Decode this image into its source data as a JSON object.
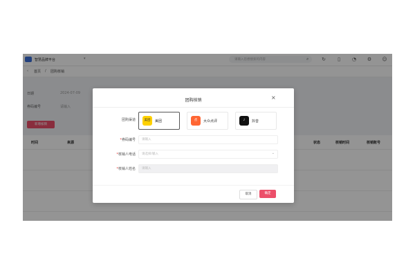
{
  "app": {
    "name": "智慧品牌平台",
    "search_placeholder": "请输入您想搜索的内容"
  },
  "breadcrumb": [
    "首页",
    "团购核销"
  ],
  "filters": {
    "date_label": "日期",
    "date_value": "2024-07-09",
    "code_label": "券码编号",
    "code_value": "请输入"
  },
  "toolbar": {
    "add_label": "新增核销"
  },
  "table": {
    "headers": [
      "时间",
      "来源",
      "状态",
      "核销时间",
      "核销账号"
    ]
  },
  "modal": {
    "title": "团购核销",
    "channel_label": "团购渠道",
    "channels": [
      {
        "name": "美团",
        "icon_text": "美团",
        "color": "#ffd100"
      },
      {
        "name": "大众点评",
        "icon_text": "点",
        "color": "#ff6633"
      },
      {
        "name": "抖音",
        "icon_text": "♪",
        "color": "#111111"
      }
    ],
    "code_label": "券码编号",
    "code_placeholder": "请输入",
    "phone_label": "核销人电话",
    "phone_placeholder": "请选择/输入",
    "name_label": "核销人姓名",
    "name_placeholder": "请输入",
    "cancel_label": "取消",
    "ok_label": "确定"
  },
  "colors": {
    "accent": "#ec4f6a",
    "brand": "#3b6fd8"
  }
}
